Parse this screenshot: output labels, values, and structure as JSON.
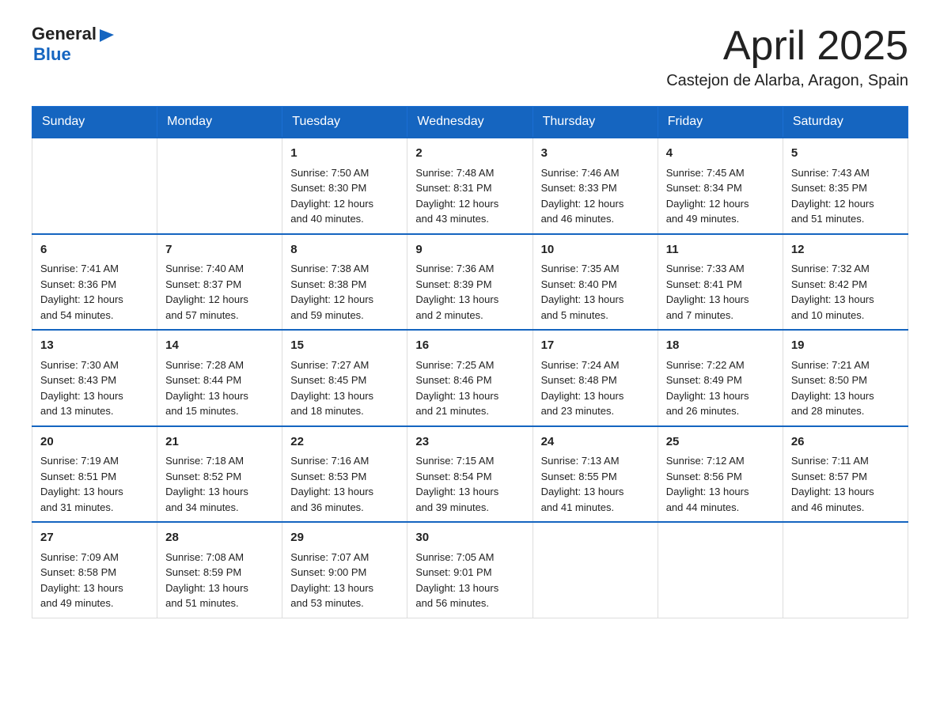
{
  "header": {
    "logo": {
      "general": "General",
      "blue": "Blue",
      "arrow": "▶"
    },
    "title": "April 2025",
    "location": "Castejon de Alarba, Aragon, Spain"
  },
  "calendar": {
    "days": [
      "Sunday",
      "Monday",
      "Tuesday",
      "Wednesday",
      "Thursday",
      "Friday",
      "Saturday"
    ],
    "weeks": [
      [
        {
          "day": "",
          "content": ""
        },
        {
          "day": "",
          "content": ""
        },
        {
          "day": "1",
          "content": "Sunrise: 7:50 AM\nSunset: 8:30 PM\nDaylight: 12 hours\nand 40 minutes."
        },
        {
          "day": "2",
          "content": "Sunrise: 7:48 AM\nSunset: 8:31 PM\nDaylight: 12 hours\nand 43 minutes."
        },
        {
          "day": "3",
          "content": "Sunrise: 7:46 AM\nSunset: 8:33 PM\nDaylight: 12 hours\nand 46 minutes."
        },
        {
          "day": "4",
          "content": "Sunrise: 7:45 AM\nSunset: 8:34 PM\nDaylight: 12 hours\nand 49 minutes."
        },
        {
          "day": "5",
          "content": "Sunrise: 7:43 AM\nSunset: 8:35 PM\nDaylight: 12 hours\nand 51 minutes."
        }
      ],
      [
        {
          "day": "6",
          "content": "Sunrise: 7:41 AM\nSunset: 8:36 PM\nDaylight: 12 hours\nand 54 minutes."
        },
        {
          "day": "7",
          "content": "Sunrise: 7:40 AM\nSunset: 8:37 PM\nDaylight: 12 hours\nand 57 minutes."
        },
        {
          "day": "8",
          "content": "Sunrise: 7:38 AM\nSunset: 8:38 PM\nDaylight: 12 hours\nand 59 minutes."
        },
        {
          "day": "9",
          "content": "Sunrise: 7:36 AM\nSunset: 8:39 PM\nDaylight: 13 hours\nand 2 minutes."
        },
        {
          "day": "10",
          "content": "Sunrise: 7:35 AM\nSunset: 8:40 PM\nDaylight: 13 hours\nand 5 minutes."
        },
        {
          "day": "11",
          "content": "Sunrise: 7:33 AM\nSunset: 8:41 PM\nDaylight: 13 hours\nand 7 minutes."
        },
        {
          "day": "12",
          "content": "Sunrise: 7:32 AM\nSunset: 8:42 PM\nDaylight: 13 hours\nand 10 minutes."
        }
      ],
      [
        {
          "day": "13",
          "content": "Sunrise: 7:30 AM\nSunset: 8:43 PM\nDaylight: 13 hours\nand 13 minutes."
        },
        {
          "day": "14",
          "content": "Sunrise: 7:28 AM\nSunset: 8:44 PM\nDaylight: 13 hours\nand 15 minutes."
        },
        {
          "day": "15",
          "content": "Sunrise: 7:27 AM\nSunset: 8:45 PM\nDaylight: 13 hours\nand 18 minutes."
        },
        {
          "day": "16",
          "content": "Sunrise: 7:25 AM\nSunset: 8:46 PM\nDaylight: 13 hours\nand 21 minutes."
        },
        {
          "day": "17",
          "content": "Sunrise: 7:24 AM\nSunset: 8:48 PM\nDaylight: 13 hours\nand 23 minutes."
        },
        {
          "day": "18",
          "content": "Sunrise: 7:22 AM\nSunset: 8:49 PM\nDaylight: 13 hours\nand 26 minutes."
        },
        {
          "day": "19",
          "content": "Sunrise: 7:21 AM\nSunset: 8:50 PM\nDaylight: 13 hours\nand 28 minutes."
        }
      ],
      [
        {
          "day": "20",
          "content": "Sunrise: 7:19 AM\nSunset: 8:51 PM\nDaylight: 13 hours\nand 31 minutes."
        },
        {
          "day": "21",
          "content": "Sunrise: 7:18 AM\nSunset: 8:52 PM\nDaylight: 13 hours\nand 34 minutes."
        },
        {
          "day": "22",
          "content": "Sunrise: 7:16 AM\nSunset: 8:53 PM\nDaylight: 13 hours\nand 36 minutes."
        },
        {
          "day": "23",
          "content": "Sunrise: 7:15 AM\nSunset: 8:54 PM\nDaylight: 13 hours\nand 39 minutes."
        },
        {
          "day": "24",
          "content": "Sunrise: 7:13 AM\nSunset: 8:55 PM\nDaylight: 13 hours\nand 41 minutes."
        },
        {
          "day": "25",
          "content": "Sunrise: 7:12 AM\nSunset: 8:56 PM\nDaylight: 13 hours\nand 44 minutes."
        },
        {
          "day": "26",
          "content": "Sunrise: 7:11 AM\nSunset: 8:57 PM\nDaylight: 13 hours\nand 46 minutes."
        }
      ],
      [
        {
          "day": "27",
          "content": "Sunrise: 7:09 AM\nSunset: 8:58 PM\nDaylight: 13 hours\nand 49 minutes."
        },
        {
          "day": "28",
          "content": "Sunrise: 7:08 AM\nSunset: 8:59 PM\nDaylight: 13 hours\nand 51 minutes."
        },
        {
          "day": "29",
          "content": "Sunrise: 7:07 AM\nSunset: 9:00 PM\nDaylight: 13 hours\nand 53 minutes."
        },
        {
          "day": "30",
          "content": "Sunrise: 7:05 AM\nSunset: 9:01 PM\nDaylight: 13 hours\nand 56 minutes."
        },
        {
          "day": "",
          "content": ""
        },
        {
          "day": "",
          "content": ""
        },
        {
          "day": "",
          "content": ""
        }
      ]
    ]
  }
}
